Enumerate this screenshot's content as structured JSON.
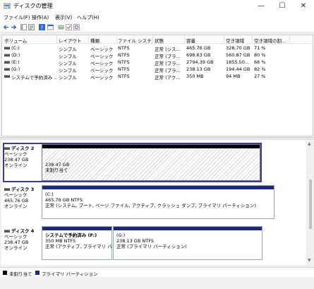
{
  "window": {
    "title": "ディスクの管理",
    "minimize_glyph": "—",
    "maximize_glyph": "☐",
    "close_glyph": "✕"
  },
  "menu": [
    "ファイル(F)",
    "操作(A)",
    "表示(V)",
    "ヘルプ(H)"
  ],
  "volume_table": {
    "columns": [
      "ボリューム",
      "レイアウト",
      "種類",
      "ファイル システム",
      "状態",
      "容量",
      "空き領域",
      "空き領域の割..."
    ],
    "rows": [
      [
        "(C:)",
        "シンプル",
        "ベーシック",
        "NTFS",
        "正常 (シス...",
        "465.76 GB",
        "328.70 GB",
        "71 %"
      ],
      [
        "(D:)",
        "シンプル",
        "ベーシック",
        "NTFS",
        "正常 (プラ...",
        "698.63 GB",
        "560.87 GB",
        "80 %"
      ],
      [
        "(E:)",
        "シンプル",
        "ベーシック",
        "NTFS",
        "正常 (プラ...",
        "2794.39 GB",
        "1855.50...",
        "66 %"
      ],
      [
        "(G:)",
        "シンプル",
        "ベーシック",
        "NTFS",
        "正常 (プラ...",
        "238.13 GB",
        "194.44 GB",
        "82 %"
      ],
      [
        "システムで予約済み ...",
        "シンプル",
        "ベーシック",
        "NTFS",
        "正常 (アク...",
        "350 MB",
        "94 MB",
        "27 %"
      ]
    ]
  },
  "disks": [
    {
      "name": "ディスク 2",
      "type": "ベーシック",
      "size": "238.47 GB",
      "status": "オンライン",
      "partitions": [
        {
          "line1": "238.47 GB",
          "line2": "未割り当て",
          "line3": ""
        }
      ]
    },
    {
      "name": "ディスク 3",
      "type": "ベーシック",
      "size": "465.76 GB",
      "status": "オンライン",
      "partitions": [
        {
          "line1": "(C:)",
          "line2": "465.76 GB NTFS",
          "line3": "正常 (システム, ブート, ページ ファイル, アクティブ, クラッシュ ダンプ, プライマリ パーティション)"
        }
      ]
    },
    {
      "name": "ディスク 4",
      "type": "ベーシック",
      "size": "238.47 GB",
      "status": "オンライン",
      "partitions": [
        {
          "line1": "システムで予約済み  (F:)",
          "line2": "350 MB NTFS",
          "line3": "正常 (アクティブ, プライマリ パーテ"
        },
        {
          "line1": "(G:)",
          "line2": "238.13 GB NTFS",
          "line3": "正常 (プライマリ パーティション)"
        }
      ]
    }
  ],
  "legend": [
    {
      "label": "未割り当て",
      "color": "#000000"
    },
    {
      "label": "プライマリ パーティション",
      "color": "#1e2a78"
    }
  ],
  "colors": {
    "primary_partition": "#1e2a78",
    "unallocated": "#000000",
    "selection_border": "#3a3aa0"
  }
}
